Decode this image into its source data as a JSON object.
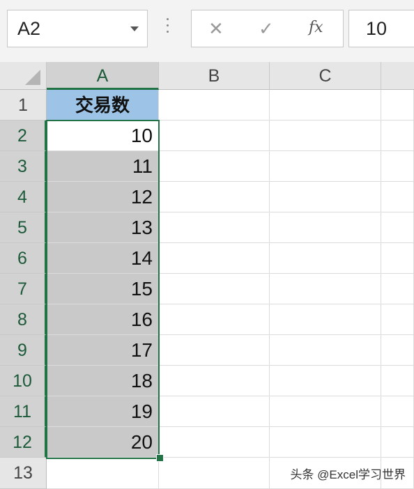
{
  "name_box": "A2",
  "formula_value": "10",
  "formula_icons": {
    "cancel": "cancel-icon",
    "enter": "enter-icon",
    "function": "fx-icon"
  },
  "formula_symbols": {
    "cancel": "✕",
    "enter": "✓",
    "function": "fx"
  },
  "columns": [
    "A",
    "B",
    "C"
  ],
  "rows": [
    "1",
    "2",
    "3",
    "4",
    "5",
    "6",
    "7",
    "8",
    "9",
    "10",
    "11",
    "12",
    "13"
  ],
  "header_cell": "交易数",
  "values": [
    "10",
    "11",
    "12",
    "13",
    "14",
    "15",
    "16",
    "17",
    "18",
    "19",
    "20"
  ],
  "watermark": "头条 @Excel学习世界",
  "colors": {
    "accent": "#217346",
    "header_fill": "#9dc3e6",
    "selection_fill": "#c9c9c9"
  }
}
